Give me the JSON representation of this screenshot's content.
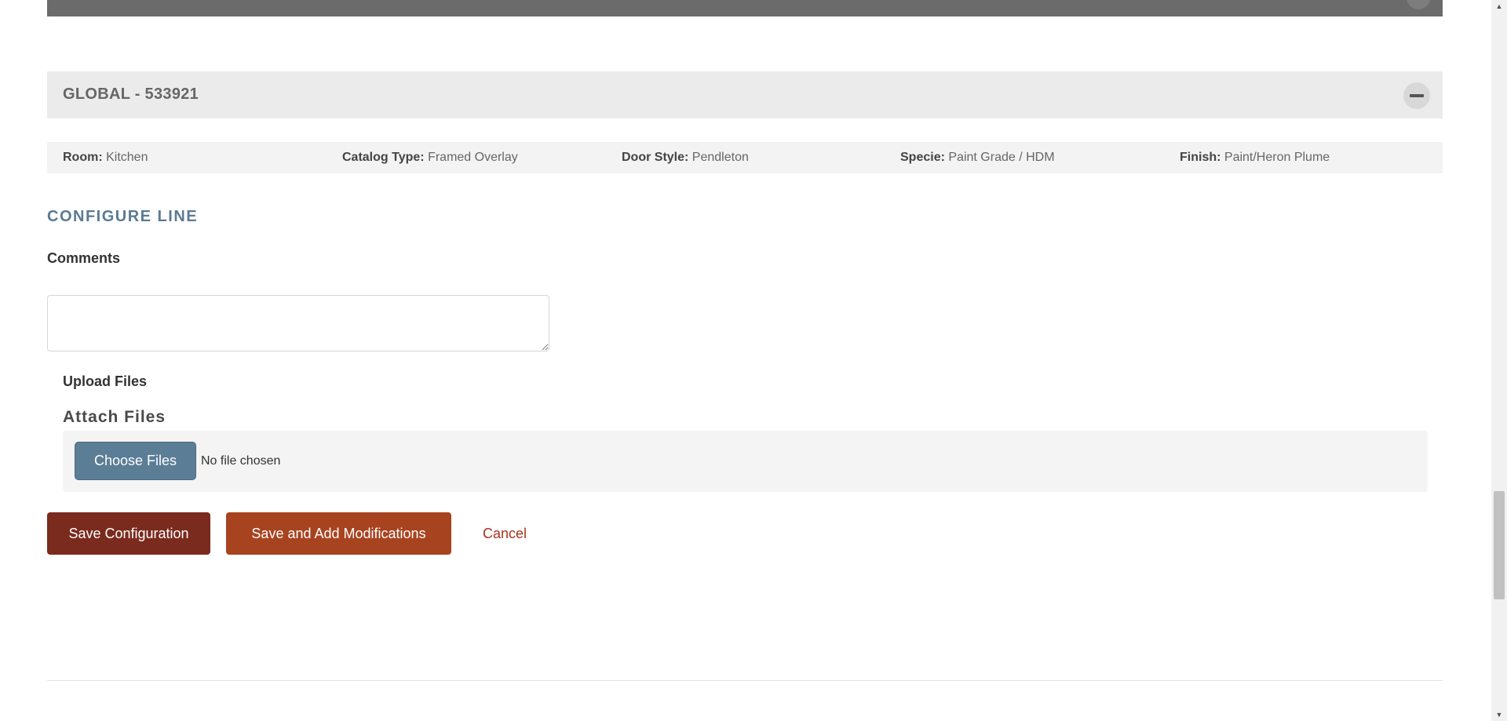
{
  "global": {
    "title": "GLOBAL - 533921"
  },
  "info": {
    "room_label": "Room:",
    "room_value": "Kitchen",
    "catalog_label": "Catalog Type:",
    "catalog_value": "Framed Overlay",
    "door_label": "Door Style:",
    "door_value": "Pendleton",
    "specie_label": "Specie:",
    "specie_value": "Paint Grade / HDM",
    "finish_label": "Finish:",
    "finish_value": "Paint/Heron Plume"
  },
  "configure": {
    "title": "CONFIGURE LINE",
    "comments_label": "Comments",
    "comments_value": "",
    "upload_label": "Upload Files",
    "attach_title": "Attach Files",
    "choose_files_label": "Choose Files",
    "no_file_text": "No file chosen"
  },
  "actions": {
    "save_label": "Save Configuration",
    "save_mod_label": "Save and Add Modifications",
    "cancel_label": "Cancel"
  },
  "colors": {
    "section_title": "#5a7a93",
    "choose_button": "#5b7d96",
    "save_button": "#7b2a1e",
    "save_mod_button": "#a84320",
    "cancel_link": "#a8321c"
  },
  "icons": {
    "collapse": "minus-icon",
    "scroll_up": "arrow-up-icon",
    "scroll_down": "arrow-down-icon"
  }
}
